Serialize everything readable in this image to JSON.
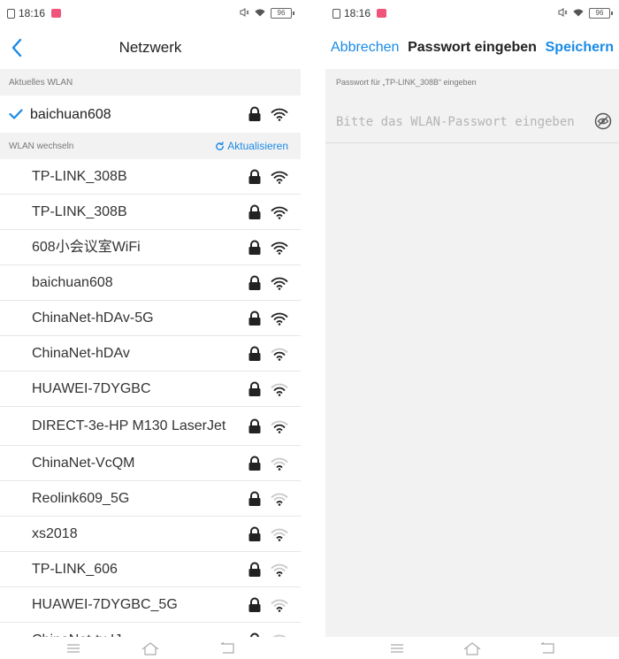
{
  "status": {
    "time": "18:16",
    "battery": "96"
  },
  "left": {
    "title": "Netzwerk",
    "current_section": "Aktuelles WLAN",
    "current_network": "baichuan608",
    "switch_section": "WLAN wechseln",
    "refresh_label": "Aktualisieren",
    "networks": [
      {
        "ssid": "TP-LINK_308B",
        "signal": "strong"
      },
      {
        "ssid": "TP-LINK_308B",
        "signal": "strong"
      },
      {
        "ssid": "608小会议室WiFi",
        "signal": "strong"
      },
      {
        "ssid": "baichuan608",
        "signal": "strong"
      },
      {
        "ssid": "ChinaNet-hDAv-5G",
        "signal": "strong"
      },
      {
        "ssid": "ChinaNet-hDAv",
        "signal": "medium"
      },
      {
        "ssid": "HUAWEI-7DYGBC",
        "signal": "medium"
      },
      {
        "ssid": "DIRECT-3e-HP M130 LaserJet",
        "signal": "medium"
      },
      {
        "ssid": "ChinaNet-VcQM",
        "signal": "weak"
      },
      {
        "ssid": "Reolink609_5G",
        "signal": "weak"
      },
      {
        "ssid": "xs2018",
        "signal": "weak"
      },
      {
        "ssid": "TP-LINK_606",
        "signal": "weak"
      },
      {
        "ssid": "HUAWEI-7DYGBC_5G",
        "signal": "weak"
      },
      {
        "ssid": "ChinaNet-tx.IJ",
        "signal": "weak"
      }
    ]
  },
  "right": {
    "cancel_label": "Abbrechen",
    "title": "Passwort eingeben",
    "save_label": "Speichern",
    "hint": "Passwort für „TP-LINK_308B“ eingeben",
    "placeholder": "Bitte das WLAN-Passwort eingeben"
  },
  "icons": {
    "back": "chevron-left-icon",
    "check": "check-icon",
    "refresh": "refresh-icon",
    "lock": "lock-icon",
    "wifi": "wifi-icon",
    "eye": "eye-off-icon",
    "menu": "menu-icon",
    "home": "home-icon",
    "recent": "back-icon"
  },
  "colors": {
    "accent": "#1a8ae5",
    "section_bg": "#f2f2f2"
  }
}
